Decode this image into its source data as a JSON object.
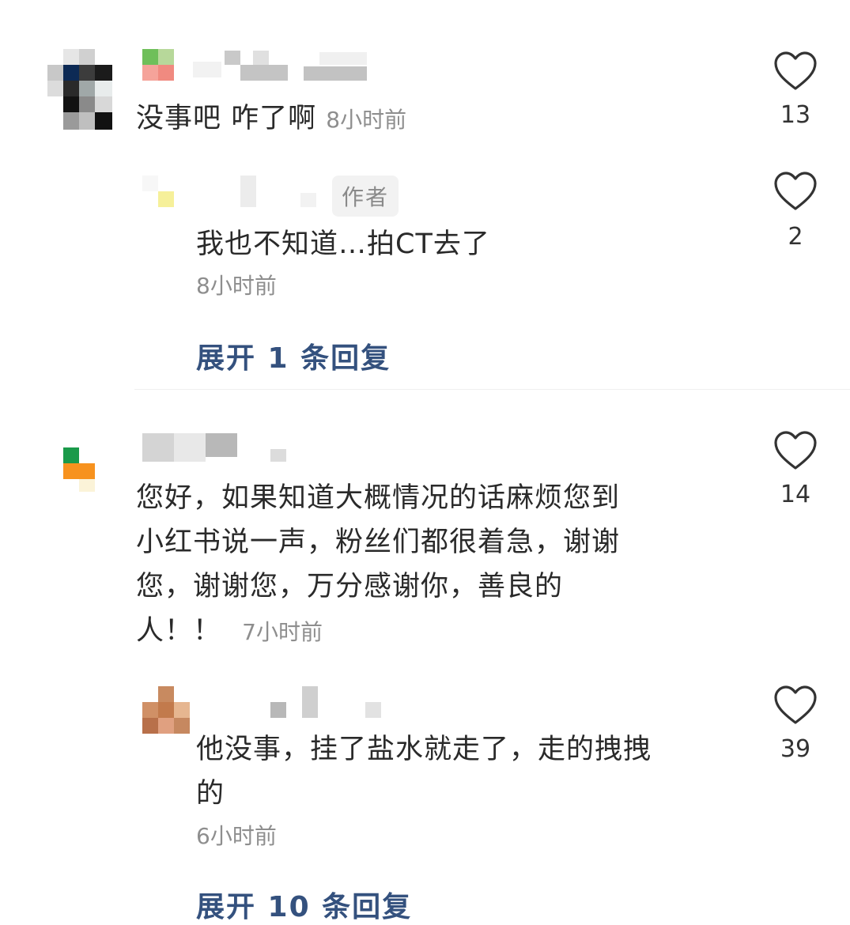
{
  "comments": [
    {
      "text": "没事吧 咋了啊",
      "time": "8小时前",
      "likes": "13",
      "reply": {
        "author_badge": "作者",
        "text": "我也不知道…拍CT去了",
        "time": "8小时前",
        "likes": "2"
      },
      "expand_label": "展开 1 条回复"
    },
    {
      "text_lines": [
        "您好，如果知道大概情况的话麻烦您到",
        "小红书说一声，粉丝们都很着急，谢谢",
        "您，谢谢您，万分感谢你，善良的",
        "人！！"
      ],
      "time": "7小时前",
      "likes": "14",
      "reply": {
        "text_lines": [
          "他没事，挂了盐水就走了，走的拽拽",
          "的"
        ],
        "time": "6小时前",
        "likes": "39"
      },
      "expand_label": "展开 10 条回复"
    }
  ],
  "icons": {
    "like": "heart-outline-icon"
  },
  "colors": {
    "expand_link": "#34517e",
    "time_text": "#8e8e8e"
  }
}
